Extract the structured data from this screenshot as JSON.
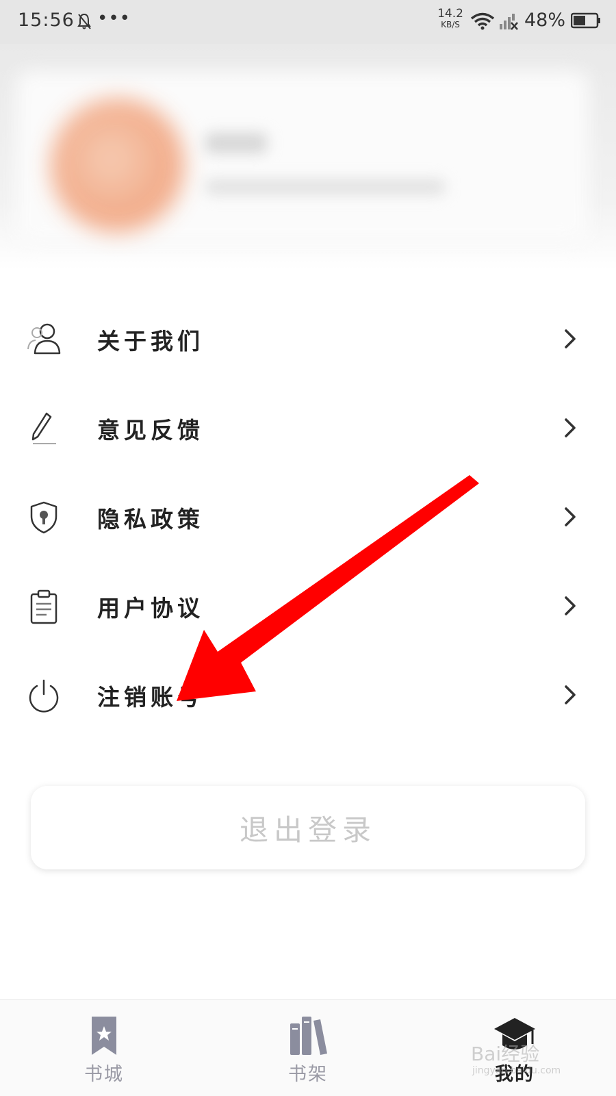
{
  "status_bar": {
    "time": "15:56",
    "more": "•••",
    "net_speed_value": "14.2",
    "net_speed_unit": "KB/S",
    "battery_percent": "48%"
  },
  "menu": {
    "items": [
      {
        "label": "关于我们",
        "icon": "user-icon"
      },
      {
        "label": "意见反馈",
        "icon": "pencil-icon"
      },
      {
        "label": "隐私政策",
        "icon": "shield-icon"
      },
      {
        "label": "用户协议",
        "icon": "clipboard-icon"
      },
      {
        "label": "注销账号",
        "icon": "power-icon"
      }
    ]
  },
  "logout_button": {
    "label": "退出登录"
  },
  "bottom_nav": {
    "items": [
      {
        "label": "书城",
        "icon": "bookmark-star-icon",
        "active": false
      },
      {
        "label": "书架",
        "icon": "books-icon",
        "active": false
      },
      {
        "label": "我的",
        "icon": "graduation-cap-icon",
        "active": true
      }
    ]
  },
  "watermark": {
    "text": "Bai经验",
    "sub": "jingyan.baidu.com"
  },
  "colors": {
    "accent_arrow": "#ff0000",
    "text_primary": "#222222",
    "nav_inactive": "#9a9aa5"
  }
}
